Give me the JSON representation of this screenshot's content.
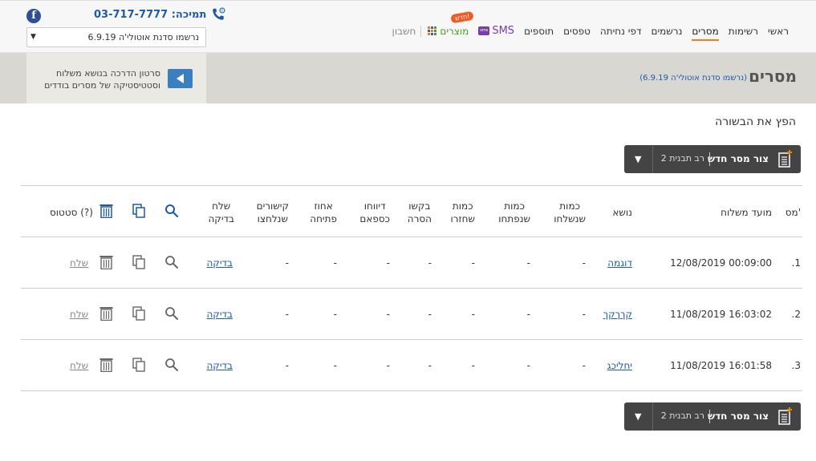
{
  "nav": {
    "items": [
      "ראשי",
      "רשימות",
      "מסרים",
      "נרשמים",
      "דפי נחיתה",
      "טפסים",
      "תוספים"
    ],
    "active": "מסרים",
    "sms": "SMS",
    "sms_bubble": "sms",
    "products": "מוצרים",
    "new_badge": "חדש!",
    "account": "חשבון"
  },
  "support": {
    "label": "תמיכה: 03-717-7777"
  },
  "account_select": {
    "value": "נרשמו סדנת אוטולי'ה 6.9.19"
  },
  "header": {
    "title": "מסרים",
    "subtitle": "(נרשמו סדנת אוטולי'ה 6.9.19)",
    "video_line1": "סרטון הדרכה בנושא משלוח",
    "video_line2": "וסטטיסטיקה של מסרים בודדים"
  },
  "spread_news": "הפץ את הבשורה",
  "new_message": {
    "label": "צור מסר חדש",
    "template": "רב תבנית 2"
  },
  "table": {
    "headers": {
      "num": "מס'",
      "send_time": "מועד משלוח",
      "subject": "נושא",
      "sent_1": "כמות",
      "sent_2": "שנשלחו",
      "opened_1": "כמות",
      "opened_2": "שנפתחו",
      "returned_1": "כמות",
      "returned_2": "שחזרו",
      "removal_1": "בקשו",
      "removal_2": "הסרה",
      "spam_1": "דיווחו",
      "spam_2": "כספאם",
      "open_pct_1": "אחוז",
      "open_pct_2": "פתיחה",
      "links_1": "קישורים",
      "links_2": "שנלחצו",
      "test_1": "שלח",
      "test_2": "בדיקה",
      "status": "סטטוס (?)"
    },
    "rows": [
      {
        "num": ".1",
        "time": "12/08/2019 00:09:00",
        "subject": "דוגמה",
        "sent": "-",
        "opened": "-",
        "returned": "-",
        "removal": "-",
        "spam": "-",
        "open_pct": "-",
        "links": "-",
        "test": "בדיקה",
        "status": "שלח"
      },
      {
        "num": ".2",
        "time": "11/08/2019 16:03:02",
        "subject": "קךךקך",
        "sent": "-",
        "opened": "-",
        "returned": "-",
        "removal": "-",
        "spam": "-",
        "open_pct": "-",
        "links": "-",
        "test": "בדיקה",
        "status": "שלח"
      },
      {
        "num": ".3",
        "time": "11/08/2019 16:01:58",
        "subject": "יחליכג",
        "sent": "-",
        "opened": "-",
        "returned": "-",
        "removal": "-",
        "spam": "-",
        "open_pct": "-",
        "links": "-",
        "test": "בדיקה",
        "status": "שלח"
      }
    ]
  },
  "colors": {
    "accent": "#e8811a",
    "link": "#1f5aa8",
    "band": "#d9d7d2",
    "button": "#444444"
  },
  "icons": {
    "search": "search-icon",
    "copy": "copy-icon",
    "delete": "trash-icon",
    "doc": "new-doc-icon"
  }
}
